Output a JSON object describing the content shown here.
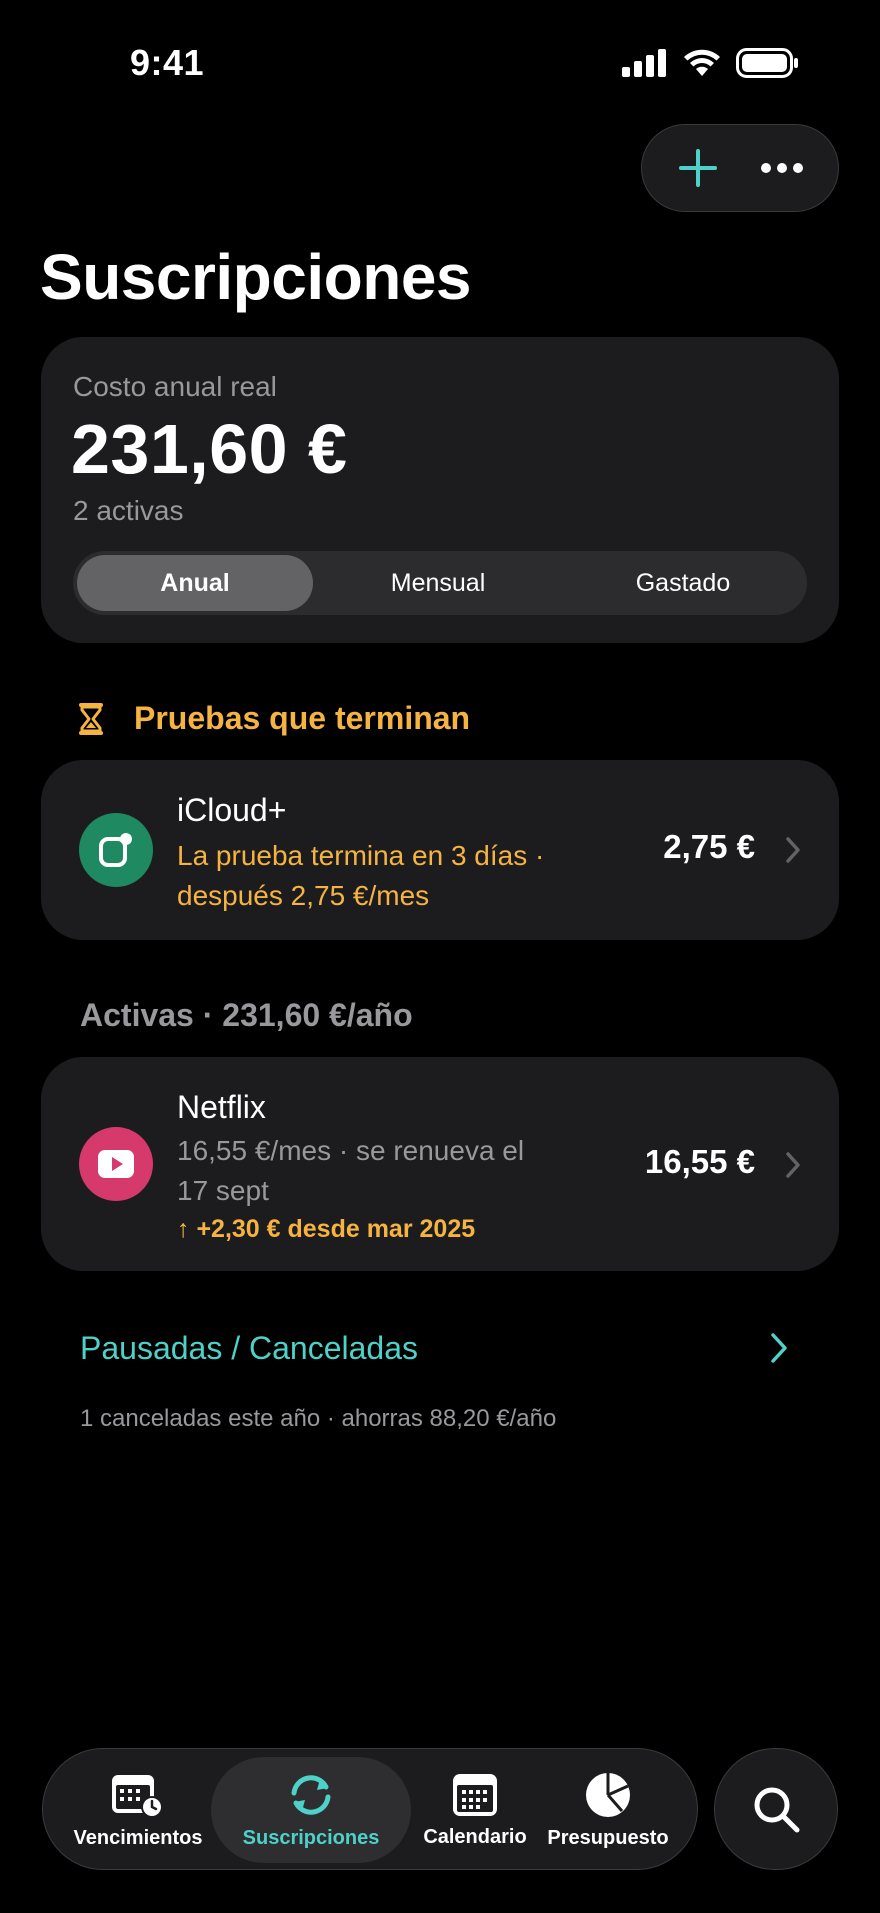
{
  "status_bar": {
    "time": "9:41"
  },
  "header": {
    "title": "Suscripciones"
  },
  "summary": {
    "label": "Costo anual real",
    "amount": "231,60 €",
    "sub": "2 activas",
    "segments": [
      "Anual",
      "Mensual",
      "Gastado"
    ],
    "selected_segment": "Anual"
  },
  "trials": {
    "header": "Pruebas que terminan",
    "items": [
      {
        "name": "iCloud+",
        "line1": "La prueba termina en 3 días ·",
        "line2": "después 2,75 €/mes",
        "price": "2,75 €"
      }
    ]
  },
  "active": {
    "header": "Activas · 231,60 €/año",
    "items": [
      {
        "name": "Netflix",
        "line1": "16,55 €/mes · se renueva el",
        "line2": "17 sept",
        "change": "↑ +2,30 € desde mar 2025",
        "price": "16,55 €"
      }
    ]
  },
  "paused": {
    "link": "Pausadas / Canceladas",
    "note": "1 canceladas este año · ahorras 88,20 €/año"
  },
  "tab_bar": {
    "tabs": [
      "Vencimientos",
      "Suscripciones",
      "Calendario",
      "Presupuesto"
    ],
    "active": "Suscripciones"
  },
  "colors": {
    "accent": "#4dd1c8",
    "warning": "#f5b342",
    "icloud": "#1f8a62",
    "netflix": "#d63a6c"
  }
}
